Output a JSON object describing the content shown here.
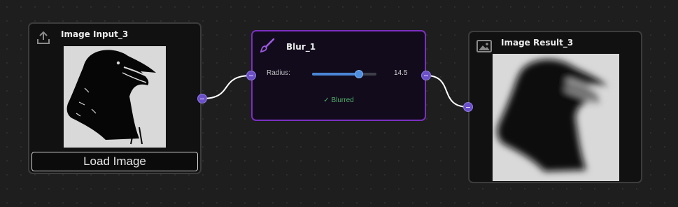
{
  "nodes": {
    "input": {
      "title": "Image Input_3",
      "icon": "upload-icon",
      "button_label": "Load Image"
    },
    "blur": {
      "title": "Blur_1",
      "icon": "brush-icon",
      "param_label": "Radius:",
      "param_value": "14.5",
      "slider_fraction": 0.73,
      "status_text": "✓ Blurred"
    },
    "result": {
      "title": "Image Result_3",
      "icon": "image-icon"
    }
  },
  "colors": {
    "canvas_bg": "#1e1e1e",
    "node_bg": "#111111",
    "node_border": "#3c3c3c",
    "selected_border": "#7b2fc0",
    "port": "#6a4fc8",
    "slider": "#4b86d6",
    "status_ok": "#4fb06a",
    "wire": "#ffffff"
  }
}
